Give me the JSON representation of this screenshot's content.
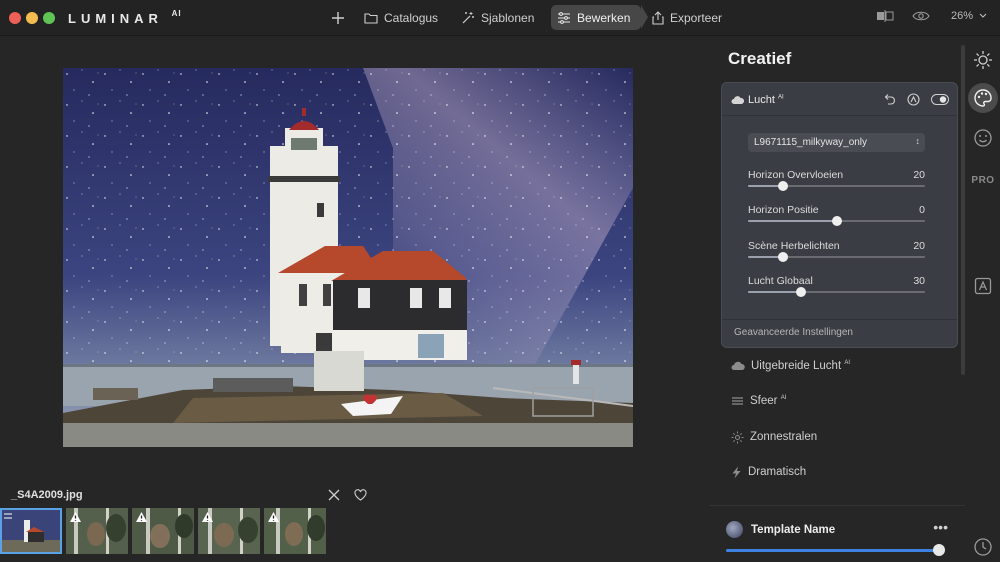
{
  "app": {
    "logo": "LUMINAR",
    "logo_suffix": "AI"
  },
  "nav": {
    "catalog": "Catalogus",
    "templates": "Sjablonen",
    "edit": "Bewerken",
    "export": "Exporteer"
  },
  "topbar": {
    "zoom": "26%"
  },
  "filmstrip": {
    "filename": "_S4A2009.jpg",
    "thumbnails": [
      {
        "selected": true,
        "warning": false
      },
      {
        "selected": false,
        "warning": true
      },
      {
        "selected": false,
        "warning": true
      },
      {
        "selected": false,
        "warning": true
      },
      {
        "selected": false,
        "warning": true
      }
    ]
  },
  "panel": {
    "title": "Creatief",
    "sky_tool": {
      "name": "Lucht",
      "ai_suffix": "AI",
      "sky_selection": "L9671115_milkyway_only",
      "sliders": [
        {
          "label": "Horizon Overvloeien",
          "value": 20,
          "min": 0,
          "max": 100
        },
        {
          "label": "Horizon Positie",
          "value": 0,
          "min": -100,
          "max": 100
        },
        {
          "label": "Scène Herbelichten",
          "value": 20,
          "min": 0,
          "max": 100
        },
        {
          "label": "Lucht Globaal",
          "value": 30,
          "min": 0,
          "max": 100
        }
      ],
      "advanced": "Geavanceerde Instellingen"
    },
    "tools": [
      {
        "label": "Uitgebreide Lucht",
        "ai": "AI",
        "icon": "cloud-icon"
      },
      {
        "label": "Sfeer",
        "ai": "AI",
        "icon": "lines-icon"
      },
      {
        "label": "Zonnestralen",
        "ai": "",
        "icon": "sun-rays-icon"
      },
      {
        "label": "Dramatisch",
        "ai": "",
        "icon": "bolt-icon"
      }
    ],
    "template": {
      "name": "Template Name",
      "amount": 0.98
    }
  },
  "rail": {
    "pro": "PRO"
  },
  "colors": {
    "accent": "#3d82e0",
    "selected_border": "#5aa1e6"
  }
}
